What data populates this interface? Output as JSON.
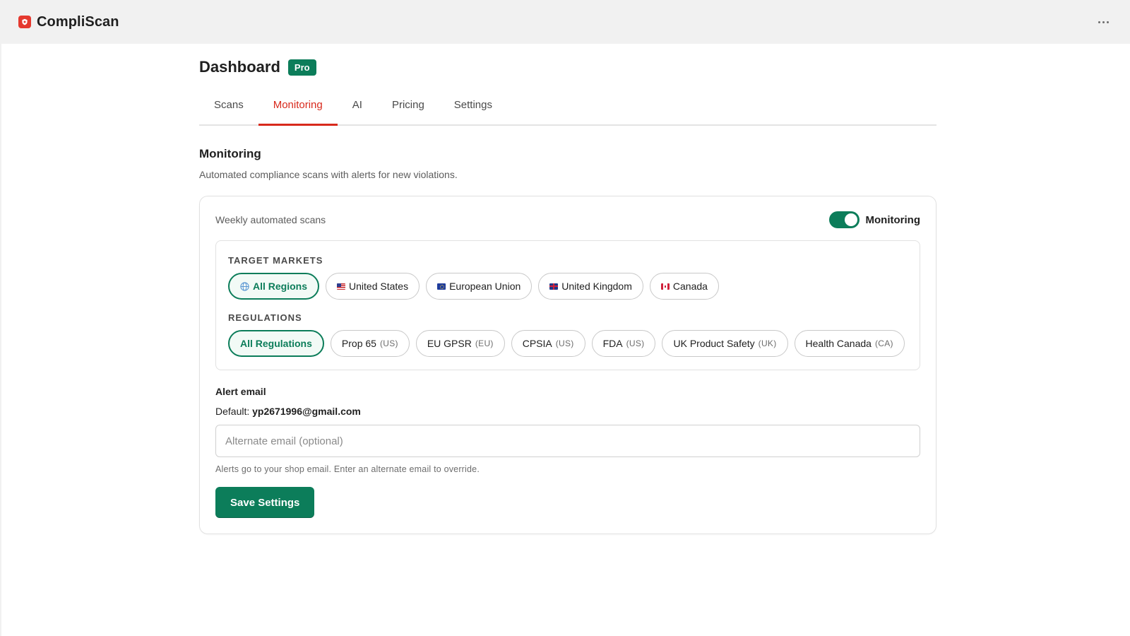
{
  "app": {
    "name": "CompliScan",
    "more_icon": "more-horizontal-icon",
    "brand_color": "#e5392f"
  },
  "header": {
    "title": "Dashboard",
    "badge": "Pro"
  },
  "tabs": [
    {
      "label": "Scans",
      "active": false
    },
    {
      "label": "Monitoring",
      "active": true
    },
    {
      "label": "AI",
      "active": false
    },
    {
      "label": "Pricing",
      "active": false
    },
    {
      "label": "Settings",
      "active": false
    }
  ],
  "section": {
    "title": "Monitoring",
    "description": "Automated compliance scans with alerts for new violations."
  },
  "card": {
    "label": "Weekly automated scans",
    "toggle_label": "Monitoring",
    "toggle_on": true
  },
  "markets": {
    "title": "TARGET MARKETS",
    "items": [
      {
        "label": "All Regions",
        "icon": "globe-icon",
        "selected": true
      },
      {
        "label": "United States",
        "icon": "flag-us",
        "selected": false
      },
      {
        "label": "European Union",
        "icon": "flag-eu",
        "selected": false
      },
      {
        "label": "United Kingdom",
        "icon": "flag-uk",
        "selected": false
      },
      {
        "label": "Canada",
        "icon": "flag-ca",
        "selected": false
      }
    ]
  },
  "regulations": {
    "title": "REGULATIONS",
    "items": [
      {
        "label": "All Regulations",
        "region": "",
        "selected": true
      },
      {
        "label": "Prop 65",
        "region": "(US)",
        "selected": false
      },
      {
        "label": "EU GPSR",
        "region": "(EU)",
        "selected": false
      },
      {
        "label": "CPSIA",
        "region": "(US)",
        "selected": false
      },
      {
        "label": "FDA",
        "region": "(US)",
        "selected": false
      },
      {
        "label": "UK Product Safety",
        "region": "(UK)",
        "selected": false
      },
      {
        "label": "Health Canada",
        "region": "(CA)",
        "selected": false
      }
    ]
  },
  "alert": {
    "title": "Alert email",
    "default_label": "Default:",
    "default_email": "yp2671996@gmail.com",
    "input_value": "",
    "input_placeholder": "Alternate email (optional)",
    "help": "Alerts go to your shop email. Enter an alternate email to override."
  },
  "save_button": "Save Settings",
  "colors": {
    "accent": "#0c7d5a",
    "active_tab": "#d8291c"
  }
}
